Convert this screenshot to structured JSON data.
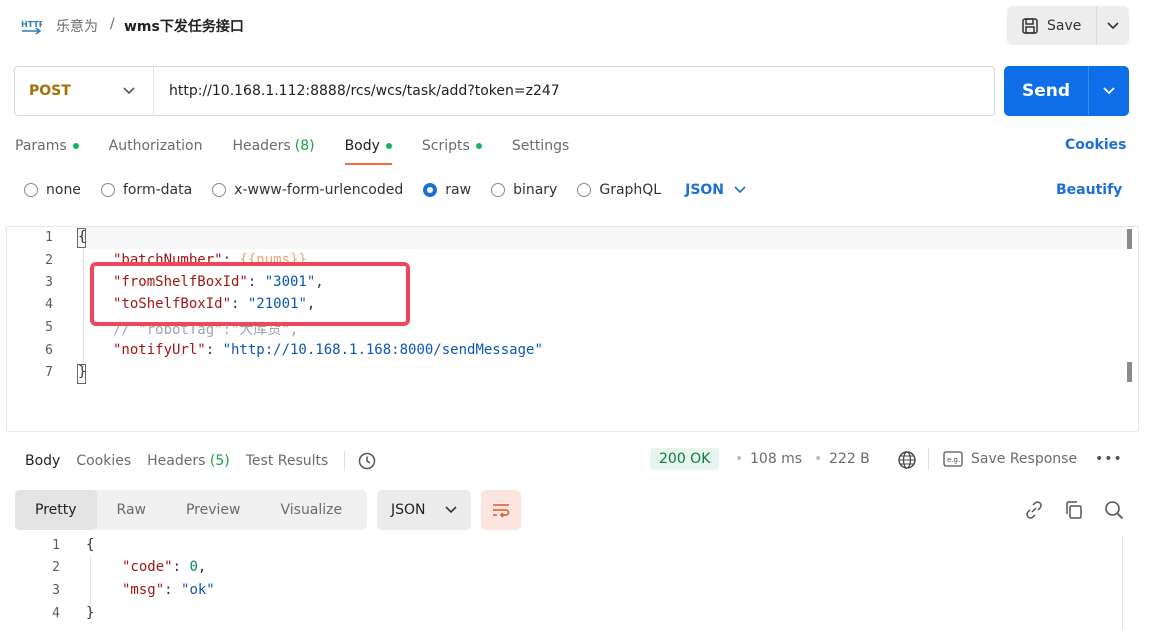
{
  "header": {
    "breadcrumb_parent": "乐意为",
    "breadcrumb_sep": "/",
    "title": "wms下发任务接口",
    "save_label": "Save"
  },
  "request": {
    "method": "POST",
    "url": "http://10.168.1.112:8888/rcs/wcs/task/add?token=z247",
    "send_label": "Send"
  },
  "tabs": [
    {
      "label": "Params",
      "dot": true
    },
    {
      "label": "Authorization"
    },
    {
      "label": "Headers",
      "count": "(8)"
    },
    {
      "label": "Body",
      "dot": true,
      "active": true
    },
    {
      "label": "Scripts",
      "dot": true
    },
    {
      "label": "Settings"
    }
  ],
  "cookies_label": "Cookies",
  "body_types": {
    "options": [
      "none",
      "form-data",
      "x-www-form-urlencoded",
      "raw",
      "binary",
      "GraphQL"
    ],
    "selected": "raw",
    "format": "JSON",
    "beautify_label": "Beautify"
  },
  "editor": {
    "line_numbers": [
      "1",
      "2",
      "3",
      "4",
      "5",
      "6",
      "7"
    ],
    "lines": {
      "l1": "{",
      "l2_key": "\"batchNumber\"",
      "l2_sep": ": ",
      "l2_val": "{{nums}}",
      "l3_key": "\"fromShelfBoxId\"",
      "l3_sep": ": ",
      "l3_val": "\"3001\"",
      "l3_end": ",",
      "l4_key": "\"toShelfBoxId\"",
      "l4_sep": ": ",
      "l4_val": "\"21001\"",
      "l4_end": ",",
      "l5": "// \"robotTag\":\"大库货\",",
      "l6_key": "\"notifyUrl\"",
      "l6_sep": ": ",
      "l6_val": "\"http://10.168.1.168:8000/sendMessage\"",
      "l7": "}"
    }
  },
  "response": {
    "tabs": [
      {
        "label": "Body",
        "active": true
      },
      {
        "label": "Cookies"
      },
      {
        "label": "Headers",
        "count": "(5)"
      },
      {
        "label": "Test Results"
      }
    ],
    "status": "200 OK",
    "time": "108 ms",
    "size": "222 B",
    "save_response_label": "Save Response",
    "more": "•••",
    "views": [
      "Pretty",
      "Raw",
      "Preview",
      "Visualize"
    ],
    "active_view": "Pretty",
    "format": "JSON",
    "line_numbers": [
      "1",
      "2",
      "3",
      "4"
    ],
    "lines": {
      "l1": "{",
      "l2_key": "\"code\"",
      "l2_sep": ": ",
      "l2_val": "0",
      "l2_end": ",",
      "l3_key": "\"msg\"",
      "l3_sep": ": ",
      "l3_val": "\"ok\"",
      "l4": "}"
    }
  },
  "colors": {
    "accent": "#0d6ee8",
    "active_tab": "#ff6c37",
    "status_dot": "#16b364",
    "highlight_box": "#f0465b"
  }
}
